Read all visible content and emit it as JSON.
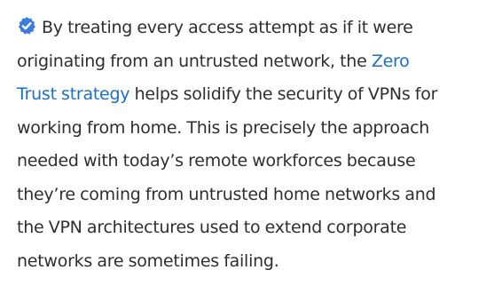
{
  "article": {
    "badge_icon": "verified-check-icon",
    "badge_color": "#3b7ce0",
    "link_color": "#1a6fc7",
    "text_color": "#2e2e2e",
    "lines": [
      "By treating every access attempt as if it were",
      "originating from an untrusted network, the ",
      "helps solidify the security of VPNs for",
      "working from home. This is precisely the approach",
      "needed with today’s remote workforces because",
      "they’re coming from untrusted home networks and",
      "the VPN architectures used to extend corporate",
      "networks are sometimes failing."
    ],
    "link_part1": "Zero",
    "link_part2": "Trust strategy"
  }
}
